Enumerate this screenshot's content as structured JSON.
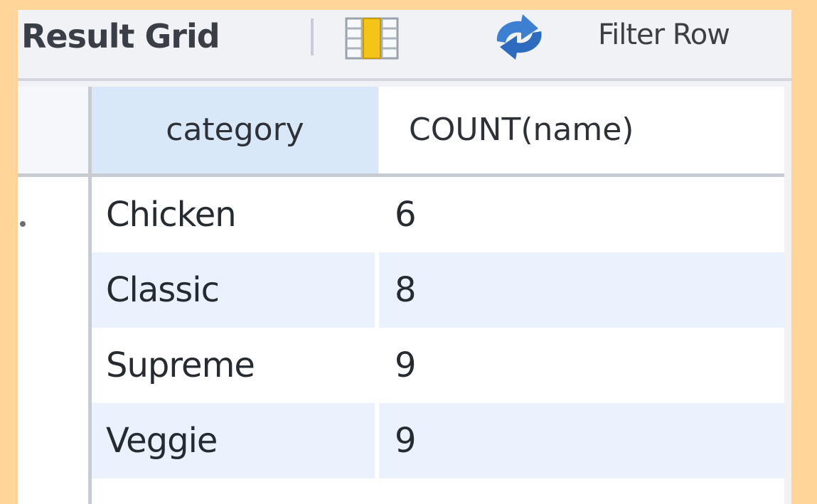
{
  "toolbar": {
    "result_grid_label": "Result Grid",
    "filter_label": "Filter Row"
  },
  "icons": {
    "grid_toggle": "grid-layout-icon",
    "refresh": "refresh-icon"
  },
  "table": {
    "columns": [
      "category",
      "COUNT(name)"
    ],
    "rows": [
      [
        "Chicken",
        "6"
      ],
      [
        "Classic",
        "8"
      ],
      [
        "Supreme",
        "9"
      ],
      [
        "Veggie",
        "9"
      ]
    ]
  },
  "colors": {
    "background": "#FFD59A",
    "header_selected": "#D9E8F8",
    "row_alt": "#EBF2FD"
  }
}
